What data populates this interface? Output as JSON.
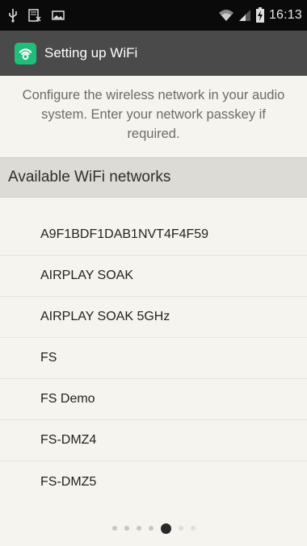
{
  "status_bar": {
    "time": "16:13",
    "left_icons": [
      "usb-icon",
      "sd-card-icon",
      "image-notification-icon"
    ],
    "right_icons": [
      "wifi-icon",
      "signal-icon",
      "battery-charging-icon"
    ]
  },
  "action_bar": {
    "title": "Setting up WiFi",
    "icon": "wifi-setup-app-icon",
    "background": "#4a4a4a",
    "icon_color": "#1fbf7a"
  },
  "intro_text": "Configure the wireless network in your audio system. Enter your network passkey if required.",
  "section_header": "Available WiFi networks",
  "networks": [
    "A9F1BDF1DAB1NVT4F4F59",
    "AIRPLAY SOAK",
    "AIRPLAY SOAK 5GHz",
    "FS",
    "FS Demo",
    "FS-DMZ4",
    "FS-DMZ5"
  ],
  "pager": {
    "total_pages": 7,
    "current_page": 5
  }
}
